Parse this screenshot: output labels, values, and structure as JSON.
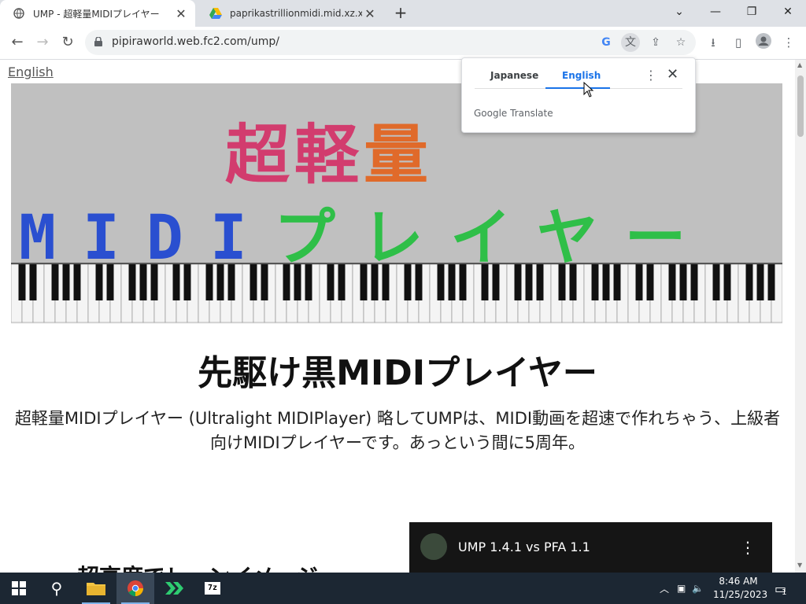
{
  "browser": {
    "tabs": [
      {
        "title": "UMP - 超軽量MIDIプレイヤー",
        "active": true
      },
      {
        "title": "paprikastrillionmidi.mid.xz.xz - G",
        "active": false
      }
    ],
    "url": "pipiraworld.web.fc2.com/ump/",
    "window_controls": [
      "chevron-down-icon",
      "minimize-icon",
      "restore-icon",
      "close-icon"
    ]
  },
  "page": {
    "language_link": "English",
    "banner": {
      "title_line1_part1": "超軽",
      "title_line1_part2": "量",
      "title_line2_midi": "MIDI",
      "title_line2_kana": "プレイヤー"
    },
    "headline": "先駆け黒MIDIプレイヤー",
    "description": "超軽量MIDIプレイヤー (Ultralight MIDIPlayer) 略してUMPは、MIDI動画を超速で作れちゃう、上級者向けMIDIプレイヤーです。あっという間に5周年。",
    "cut_heading": "超高度でレーンイメージ",
    "video": {
      "title": "UMP 1.4.1 vs PFA 1.1"
    }
  },
  "translate_popup": {
    "tab_source": "Japanese",
    "tab_target": "English",
    "brand": "Google Translate"
  },
  "taskbar": {
    "time": "8:46 AM",
    "date": "11/25/2023",
    "notification_count": "1"
  },
  "colors": {
    "translate_accent": "#1a73e8",
    "taskbar": "#1c2733",
    "banner_bg": "#c0c0c0"
  }
}
